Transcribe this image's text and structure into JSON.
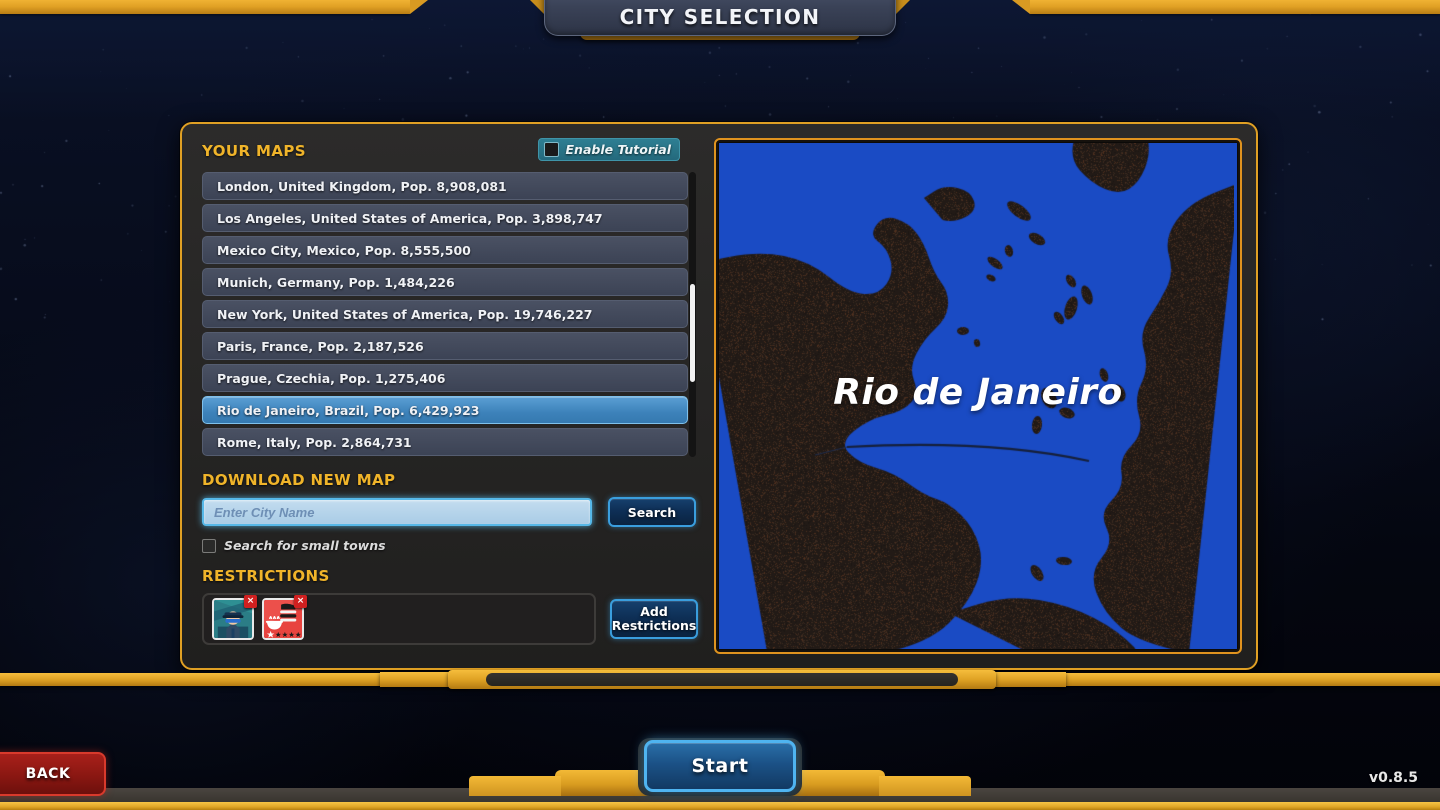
{
  "header": {
    "title": "CITY SELECTION"
  },
  "panel": {
    "maps_section_title": "YOUR MAPS",
    "tutorial": {
      "label": "Enable Tutorial",
      "checked": false
    },
    "map_list": [
      {
        "label": "London, United Kingdom, Pop. 8,908,081",
        "selected": false
      },
      {
        "label": "Los Angeles, United States of America, Pop. 3,898,747",
        "selected": false
      },
      {
        "label": "Mexico City, Mexico, Pop. 8,555,500",
        "selected": false
      },
      {
        "label": "Munich, Germany, Pop. 1,484,226",
        "selected": false
      },
      {
        "label": "New York, United States of America, Pop. 19,746,227",
        "selected": false
      },
      {
        "label": "Paris, France, Pop. 2,187,526",
        "selected": false
      },
      {
        "label": "Prague, Czechia, Pop. 1,275,406",
        "selected": false
      },
      {
        "label": "Rio de Janeiro, Brazil, Pop. 6,429,923",
        "selected": true
      },
      {
        "label": "Rome, Italy, Pop. 2,864,731",
        "selected": false
      }
    ],
    "download": {
      "section_title": "DOWNLOAD NEW MAP",
      "input_value": "",
      "input_placeholder": "Enter City Name",
      "search_button": "Search",
      "small_towns_label": "Search for small towns",
      "small_towns_checked": false
    },
    "restrictions": {
      "section_title": "RESTRICTIONS",
      "add_button_line1": "Add",
      "add_button_line2": "Restrictions",
      "items": [
        {
          "name": "police-restriction-card",
          "remove_label": "×"
        },
        {
          "name": "restaurant-restriction-card",
          "remove_label": "×"
        }
      ]
    },
    "map_preview": {
      "city_label": "Rio de Janeiro",
      "water_color": "#1a4bc4",
      "land_color": "#221a16"
    }
  },
  "footer": {
    "back_button": "BACK",
    "start_button": "Start",
    "version": "v0.8.5"
  },
  "theme": {
    "gold": "#e0a024",
    "accent_blue": "#3a9ede",
    "selected_blue": "#3d82ba",
    "teal": "#2e7f93",
    "red": "#a8201a"
  }
}
